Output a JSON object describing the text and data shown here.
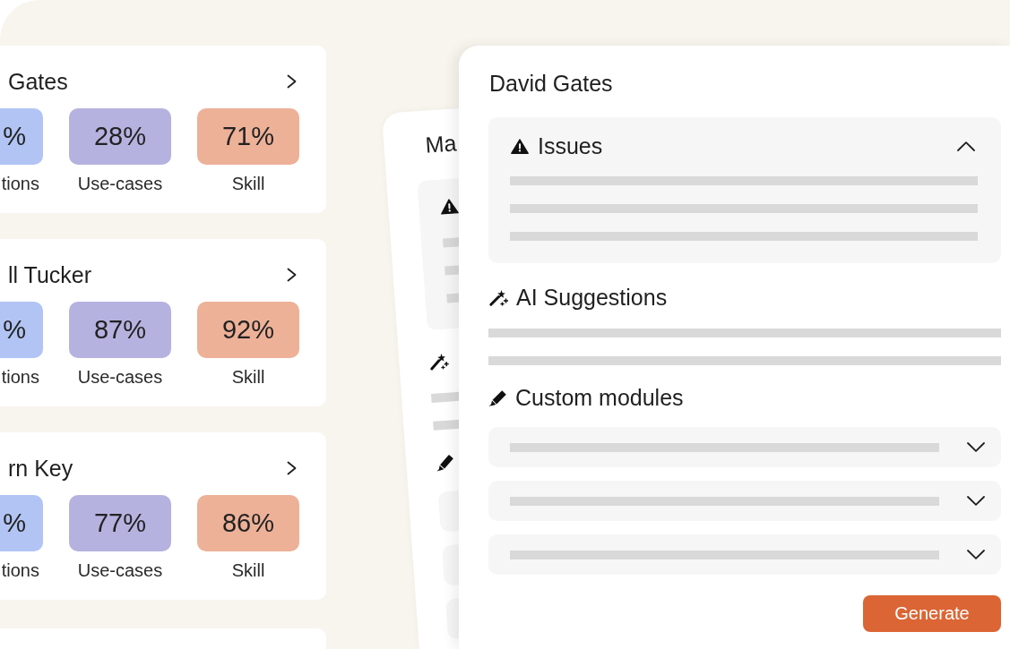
{
  "profile_cards": [
    {
      "name": "Gates",
      "metrics": [
        {
          "value": "%",
          "label": "tions",
          "color": "#b1c4f4"
        },
        {
          "value": "28%",
          "label": "Use-cases",
          "color": "#b6b2e0"
        },
        {
          "value": "71%",
          "label": "Skill",
          "color": "#edb198"
        }
      ]
    },
    {
      "name": "ll Tucker",
      "metrics": [
        {
          "value": "%",
          "label": "tions",
          "color": "#b1c4f4"
        },
        {
          "value": "87%",
          "label": "Use-cases",
          "color": "#b6b2e0"
        },
        {
          "value": "92%",
          "label": "Skill",
          "color": "#edb198"
        }
      ]
    },
    {
      "name": "rn Key",
      "metrics": [
        {
          "value": "%",
          "label": "tions",
          "color": "#b1c4f4"
        },
        {
          "value": "77%",
          "label": "Use-cases",
          "color": "#b6b2e0"
        },
        {
          "value": "86%",
          "label": "Skill",
          "color": "#edb198"
        }
      ]
    }
  ],
  "back_card": {
    "title": "Ma"
  },
  "detail_panel": {
    "title": "David Gates",
    "issues": {
      "title": "Issues",
      "expanded": true
    },
    "ai_suggestions": {
      "title": "AI Suggestions"
    },
    "custom_modules": {
      "title": "Custom modules",
      "items": [
        {
          "expanded": false
        },
        {
          "expanded": false
        },
        {
          "expanded": false
        }
      ]
    },
    "button": "Generate"
  }
}
